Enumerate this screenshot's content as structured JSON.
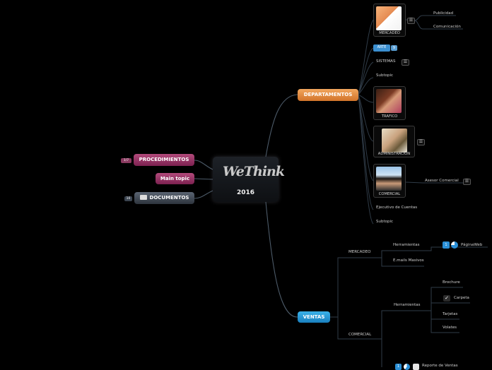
{
  "central": {
    "logo": "WeThink",
    "year": "2016"
  },
  "left": {
    "procedimientos": {
      "label": "PROCEDIMIENTOS",
      "badge": "1/7"
    },
    "main_topic": {
      "label": "Main topic"
    },
    "documentos": {
      "label": "DOCUMENTOS",
      "badge": "10"
    }
  },
  "departamentos": {
    "label": "DEPARTAMENTOS",
    "mercadeo": {
      "caption": "MERCADEO",
      "children": [
        "Publicidad",
        "Comunicación"
      ]
    },
    "arte": {
      "label": "ARTE",
      "badge": "9"
    },
    "sistemas": {
      "label": "SISTEMAS"
    },
    "subtopic1": "Subtopic",
    "trafico": {
      "caption": "TRAFICO"
    },
    "administracion": {
      "caption": "ADMINISTRACION"
    },
    "comercial": {
      "caption": "COMERCIAL",
      "child": "Asesor Comercial"
    },
    "ejecutivo": "Ejecutivo de Cuentas",
    "subtopic2": "Subtopic"
  },
  "ventas": {
    "label": "VENTAS",
    "mercadeo": {
      "label": "MERCADEO",
      "herramientas": "Herramientas",
      "pagina_web": "PáginaWeb",
      "pagina_web_badge": "1",
      "emails": "E.mails Masivos"
    },
    "comercial": {
      "label": "COMERCIAL",
      "herramientas": "Herramientas",
      "items": [
        "Brochure",
        "Carpeta",
        "Tarjetas",
        "Volates"
      ],
      "reporte": "Reporte de Ventas",
      "reporte_badge": "1"
    }
  },
  "colors": {
    "departamentos": "#e08a3c",
    "ventas": "#2a9fd8",
    "procedimientos": "#9b3566",
    "documentos": "#3f4752",
    "arte": "#3b8fd0"
  }
}
